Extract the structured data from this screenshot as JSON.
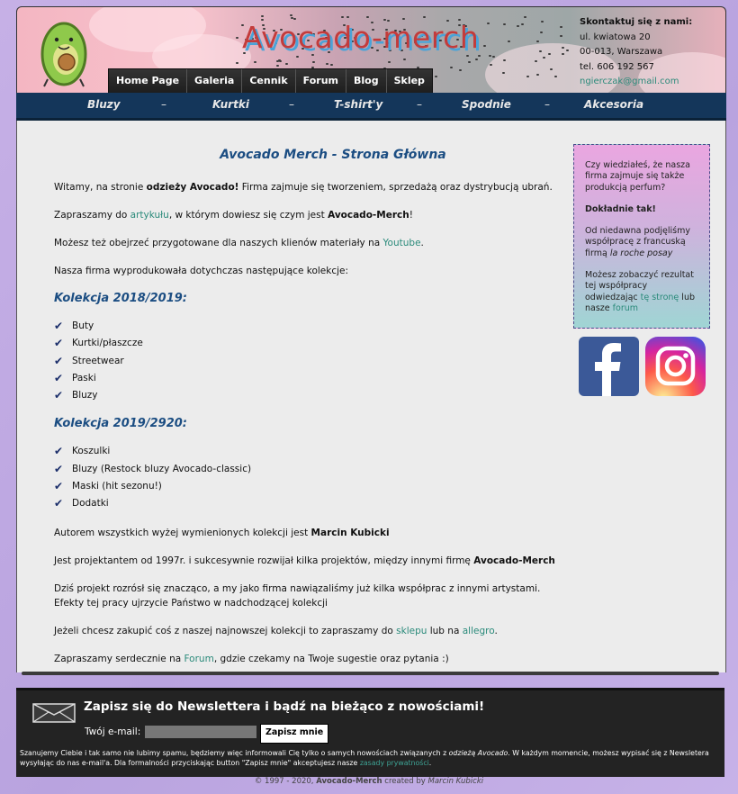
{
  "header": {
    "site_title": "Avocado-merch",
    "contact": {
      "title": "Skontaktuj się z nami:",
      "street": "ul. kwiatowa 20",
      "city": "00-013, Warszawa",
      "phone": "tel. 606 192 567",
      "email": "ngierczak@gmail.com"
    },
    "nav": [
      "Home Page",
      "Galeria",
      "Cennik",
      "Forum",
      "Blog",
      "Sklep"
    ]
  },
  "categories": [
    "Bluzy",
    "Kurtki",
    "T-shirt'y",
    "Spodnie",
    "Akcesoria"
  ],
  "category_separator": "–",
  "main": {
    "title": "Avocado Merch - Strona Główna",
    "p1": {
      "a": "Witamy, na stronie ",
      "b": "odzieży Avocado!",
      "c": " Firma zajmuje się tworzeniem, sprzedażą oraz dystrybucją ubrań."
    },
    "p2": {
      "a": "Zapraszamy do ",
      "link": "artykułu",
      "b": ", w którym dowiesz się czym jest ",
      "bold": "Avocado-Merch",
      "c": "!"
    },
    "p3": {
      "a": "Możesz też obejrzeć przygotowane dla naszych klienów materiały na ",
      "link": "Youtube",
      "b": "."
    },
    "p4": "Nasza firma wyprodukowała dotychczas następujące kolekcje:",
    "collection1_title": "Kolekcja 2018/2019:",
    "collection1_items": [
      "Buty",
      "Kurtki/płaszcze",
      "Streetwear",
      "Paski",
      "Bluzy"
    ],
    "collection2_title": "Kolekcja 2019/2920:",
    "collection2_items": [
      "Koszulki",
      "Bluzy (Restock bluzy Avocado-classic)",
      "Maski (hit sezonu!)",
      "Dodatki"
    ],
    "p5": {
      "a": "Autorem wszystkich wyżej wymienionych kolekcji jest ",
      "bold": "Marcin Kubicki"
    },
    "p6": {
      "a": "Jest projektantem od 1997r. i sukcesywnie rozwijał kilka projektów, między innymi firmę ",
      "bold": "Avocado-Merch"
    },
    "p7": "Dziś projekt rozrósł się znacząco, a my jako firma nawiązaliśmy już kilka współprac z innymi artystami. Efekty tej pracy ujrzycie Państwo w nadchodzącej kolekcji",
    "p8": {
      "a": "Jeżeli chcesz zakupić coś z naszej najnowszej kolekcji to zapraszamy do ",
      "link1": "sklepu",
      "b": " lub na ",
      "link2": "allegro",
      "c": "."
    },
    "p9": {
      "a": "Zapraszamy serdecznie na ",
      "link": "Forum",
      "b": ", gdzie czekamy na Twoje sugestie oraz pytania :)"
    }
  },
  "sidebar": {
    "q": "Czy wiedziałeś, że nasza firma zajmuje się także produkcją perfum?",
    "answer": "Dokładnie tak!",
    "s1a": "Od niedawna podjęliśmy współpracę z francuską firmą ",
    "s1b": "la roche posay",
    "s2a": "Możesz zobaczyć rezultat tej współpracy odwiedzając ",
    "s2link": "tę stronę",
    "s2b": " lub nasze ",
    "s2link2": "forum"
  },
  "newsletter": {
    "title": "Zapisz się do Newslettera i bądź na bieżąco z nowościami!",
    "email_label": "Twój e-mail:",
    "email_value": "",
    "button": "Zapisz mnie",
    "disc_a": "Szanujemy Ciebie i tak samo nie lubimy spamu, będziemy więc informowali Cię tylko o samych nowościach związanych z ",
    "disc_em": "odzieżą Avocado",
    "disc_b": ". W każdym momencie, możesz wypisać się z Newsletera wysyłając do nas e-mail'a. Dla formalności przyciskając button \"Zapisz mnie\" akceptujesz nasze ",
    "disc_link": "zasady prywatności",
    "disc_c": "."
  },
  "footer": {
    "a": "© 1997 - 2020, ",
    "brand": "Avocado-Merch",
    "b": " created by ",
    "author": "Marcin Kubicki"
  },
  "colors": {
    "category_bar": "#14365a",
    "heading": "#1b4d82",
    "link": "#2a8a7a",
    "title": "#c33b3b"
  }
}
